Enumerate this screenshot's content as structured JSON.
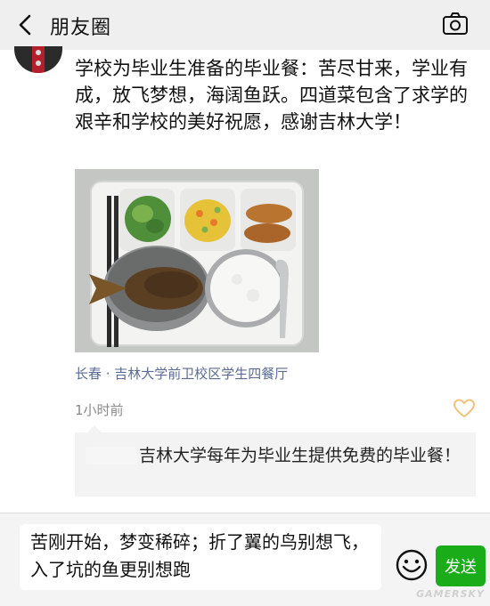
{
  "header": {
    "title": "朋友圈",
    "back_icon": "chevron-left-icon",
    "camera_icon": "camera-icon"
  },
  "post": {
    "text": "学校为毕业生准备的毕业餐：苦尽甘来，学业有成，放飞梦想，海阔鱼跃。四道菜包含了求学的艰辛和学校的美好祝愿，感谢吉林大学！",
    "photo_alt": "meal-tray-photo",
    "location": "长春 · 吉林大学前卫校区学生四餐厅",
    "time": "1小时前",
    "like_icon": "heart-outline-icon"
  },
  "comment": {
    "text": "吉林大学每年为毕业生提供免费的毕业餐！"
  },
  "input": {
    "value": "苦刚开始，梦变稀碎；折了翼的鸟别想飞，入了坑的鱼更别想跑",
    "send_label": "发送",
    "emoji_icon": "smiley-icon"
  },
  "watermark": "GAMERSKY",
  "colors": {
    "header_bg": "#efefef",
    "link_blue": "#5b6b94",
    "send_green": "#1aad19",
    "like_orange": "#f0c27a"
  }
}
